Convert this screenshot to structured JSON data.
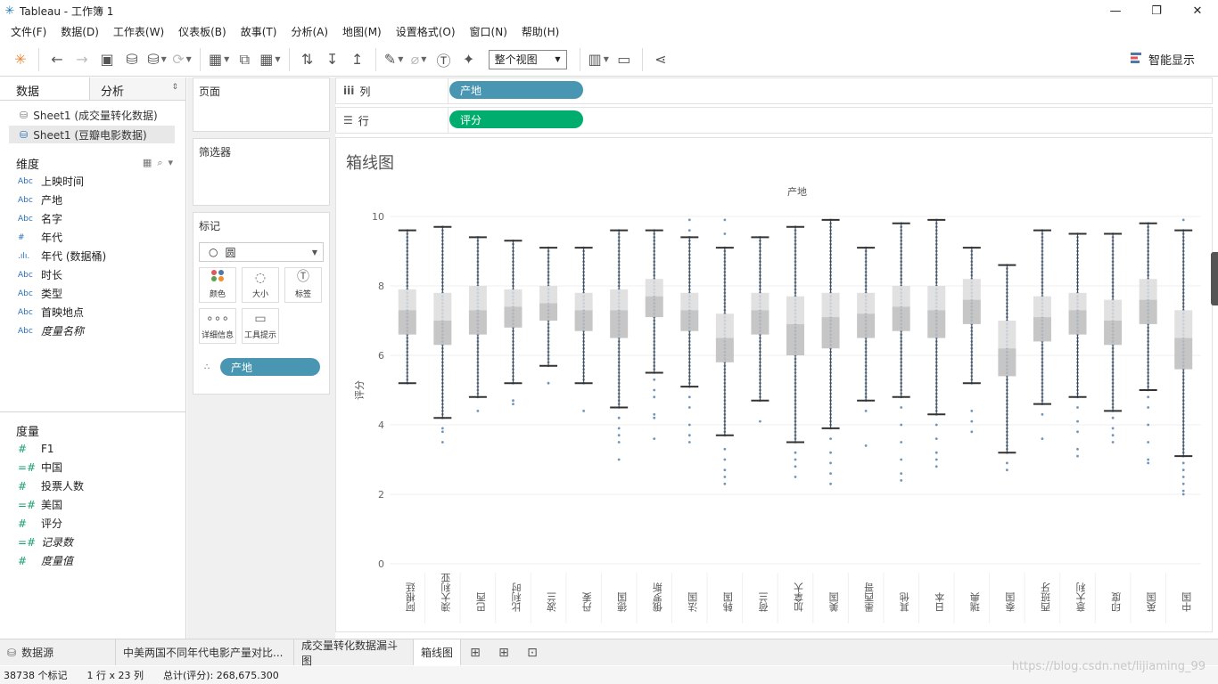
{
  "window": {
    "title": "Tableau - 工作簿 1",
    "min": "—",
    "max": "❐",
    "close": "✕"
  },
  "menu": [
    "文件(F)",
    "数据(D)",
    "工作表(W)",
    "仪表板(B)",
    "故事(T)",
    "分析(A)",
    "地图(M)",
    "设置格式(O)",
    "窗口(N)",
    "帮助(H)"
  ],
  "toolbar": {
    "view_select": "整个视图",
    "smart_show": "智能显示"
  },
  "left": {
    "tab_data": "数据",
    "tab_analysis": "分析",
    "sources": [
      "Sheet1 (成交量转化数据)",
      "Sheet1 (豆瓣电影数据)"
    ],
    "dimensions_title": "维度",
    "dimensions": [
      {
        "type": "Abc",
        "name": "上映时间"
      },
      {
        "type": "Abc",
        "name": "产地"
      },
      {
        "type": "Abc",
        "name": "名字"
      },
      {
        "type": "#",
        "name": "年代"
      },
      {
        "type": ".ılı.",
        "name": "年代 (数据桶)"
      },
      {
        "type": "Abc",
        "name": "时长"
      },
      {
        "type": "Abc",
        "name": "类型"
      },
      {
        "type": "Abc",
        "name": "首映地点"
      },
      {
        "type": "Abc",
        "name": "度量名称"
      }
    ],
    "measures_title": "度量",
    "measures": [
      {
        "type": "#",
        "name": "F1"
      },
      {
        "type": "=#",
        "name": "中国"
      },
      {
        "type": "#",
        "name": "投票人数"
      },
      {
        "type": "=#",
        "name": "美国"
      },
      {
        "type": "#",
        "name": "评分"
      },
      {
        "type": "=#",
        "name": "记录数"
      },
      {
        "type": "#",
        "name": "度量值"
      }
    ]
  },
  "cards": {
    "pages": "页面",
    "filters": "筛选器",
    "marks": "标记",
    "mark_type": "圆",
    "mark_buttons": [
      "颜色",
      "大小",
      "标签",
      "详细信息",
      "工具提示"
    ],
    "detail_pill": "产地"
  },
  "shelves": {
    "columns_label": "列",
    "columns_pill": "产地",
    "rows_label": "行",
    "rows_pill": "评分"
  },
  "sheet_title": "箱线图",
  "chart_data": {
    "type": "boxplot",
    "title": "",
    "header": "产地",
    "ylabel": "评分",
    "ylim": [
      0,
      10
    ],
    "yticks": [
      0,
      2,
      4,
      6,
      8,
      10
    ],
    "categories": [
      "阿根廷",
      "澳大利亚",
      "巴西",
      "比利时",
      "波兰",
      "丹麦",
      "德国",
      "俄罗斯",
      "法国",
      "韩国",
      "荷兰",
      "加拿大",
      "美国",
      "墨西哥",
      "其他",
      "日本",
      "瑞典",
      "泰国",
      "西班牙",
      "意大利",
      "印度",
      "英国",
      "中国"
    ],
    "box_color": "#c9c9c9",
    "point_color": "#4e79a7",
    "boxes": [
      {
        "min": 5.2,
        "q1": 6.6,
        "median": 7.3,
        "q3": 7.9,
        "max": 9.6,
        "outliers": []
      },
      {
        "min": 4.2,
        "q1": 6.3,
        "median": 7.0,
        "q3": 7.8,
        "max": 9.7,
        "outliers": [
          3.9,
          3.8,
          3.5
        ]
      },
      {
        "min": 4.8,
        "q1": 6.6,
        "median": 7.3,
        "q3": 8.0,
        "max": 9.4,
        "outliers": [
          4.4
        ]
      },
      {
        "min": 5.2,
        "q1": 6.8,
        "median": 7.4,
        "q3": 7.9,
        "max": 9.3,
        "outliers": [
          4.7,
          4.6
        ]
      },
      {
        "min": 5.7,
        "q1": 7.0,
        "median": 7.5,
        "q3": 8.0,
        "max": 9.1,
        "outliers": [
          5.2
        ]
      },
      {
        "min": 5.2,
        "q1": 6.7,
        "median": 7.3,
        "q3": 7.8,
        "max": 9.1,
        "outliers": [
          4.4
        ]
      },
      {
        "min": 4.5,
        "q1": 6.5,
        "median": 7.3,
        "q3": 7.9,
        "max": 9.6,
        "outliers": [
          4.2,
          3.9,
          3.7,
          3.5,
          3.0
        ]
      },
      {
        "min": 5.5,
        "q1": 7.1,
        "median": 7.7,
        "q3": 8.2,
        "max": 9.6,
        "outliers": [
          5.3,
          5.0,
          4.8,
          4.3,
          4.2,
          3.6
        ]
      },
      {
        "min": 5.1,
        "q1": 6.7,
        "median": 7.3,
        "q3": 7.8,
        "max": 9.4,
        "outliers": [
          4.8,
          4.5,
          4.0,
          3.7,
          3.5,
          9.6,
          9.9
        ]
      },
      {
        "min": 3.7,
        "q1": 5.8,
        "median": 6.5,
        "q3": 7.2,
        "max": 9.1,
        "outliers": [
          3.3,
          3.0,
          2.7,
          2.5,
          2.3,
          9.5,
          9.9
        ]
      },
      {
        "min": 4.7,
        "q1": 6.6,
        "median": 7.3,
        "q3": 7.8,
        "max": 9.4,
        "outliers": [
          4.1
        ]
      },
      {
        "min": 3.5,
        "q1": 6.0,
        "median": 6.9,
        "q3": 7.7,
        "max": 9.7,
        "outliers": [
          3.2,
          3.0,
          2.8,
          2.5
        ]
      },
      {
        "min": 3.9,
        "q1": 6.2,
        "median": 7.1,
        "q3": 7.8,
        "max": 9.9,
        "outliers": [
          3.6,
          3.2,
          2.9,
          2.6,
          2.3
        ]
      },
      {
        "min": 4.7,
        "q1": 6.5,
        "median": 7.2,
        "q3": 7.8,
        "max": 9.1,
        "outliers": [
          4.4,
          3.4
        ]
      },
      {
        "min": 4.8,
        "q1": 6.7,
        "median": 7.4,
        "q3": 8.0,
        "max": 9.8,
        "outliers": [
          4.5,
          4.0,
          3.5,
          3.0,
          2.6,
          2.4
        ]
      },
      {
        "min": 4.3,
        "q1": 6.5,
        "median": 7.3,
        "q3": 8.0,
        "max": 9.9,
        "outliers": [
          4.0,
          3.6,
          3.2,
          3.0,
          2.8
        ]
      },
      {
        "min": 5.2,
        "q1": 6.9,
        "median": 7.6,
        "q3": 8.2,
        "max": 9.1,
        "outliers": [
          4.4,
          4.1,
          3.8
        ]
      },
      {
        "min": 3.2,
        "q1": 5.4,
        "median": 6.2,
        "q3": 7.0,
        "max": 8.6,
        "outliers": [
          2.9,
          2.7
        ]
      },
      {
        "min": 4.6,
        "q1": 6.4,
        "median": 7.1,
        "q3": 7.7,
        "max": 9.6,
        "outliers": [
          4.3,
          3.6
        ]
      },
      {
        "min": 4.8,
        "q1": 6.6,
        "median": 7.3,
        "q3": 7.8,
        "max": 9.5,
        "outliers": [
          4.5,
          4.1,
          3.8,
          3.3,
          3.1
        ]
      },
      {
        "min": 4.4,
        "q1": 6.3,
        "median": 7.0,
        "q3": 7.6,
        "max": 9.5,
        "outliers": [
          4.2,
          3.9,
          3.7,
          3.5
        ]
      },
      {
        "min": 5.0,
        "q1": 6.9,
        "median": 7.6,
        "q3": 8.2,
        "max": 9.8,
        "outliers": [
          4.8,
          4.5,
          4.0,
          3.5,
          3.0,
          2.9
        ]
      },
      {
        "min": 3.1,
        "q1": 5.6,
        "median": 6.5,
        "q3": 7.3,
        "max": 9.6,
        "outliers": [
          2.9,
          2.7,
          2.5,
          2.3,
          2.1,
          2.0,
          9.9
        ]
      }
    ]
  },
  "sheet_tabs": {
    "datasource": "数据源",
    "tabs": [
      "中美两国不同年代电影产量对比...",
      "成交量转化数据漏斗图",
      "箱线图"
    ]
  },
  "status": {
    "marks": "38738 个标记",
    "grid": "1 行 x 23 列",
    "sum": "总计(评分): 268,675.300"
  },
  "watermark": "https://blog.csdn.net/lijiaming_99"
}
